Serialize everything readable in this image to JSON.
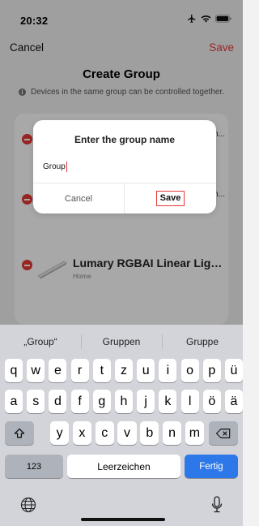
{
  "status": {
    "time": "20:32"
  },
  "nav": {
    "cancel": "Cancel",
    "save": "Save",
    "title": "Create Group",
    "info": "Devices in the same group can be controlled together."
  },
  "devices": [
    {
      "name": "",
      "room": "",
      "trailing": "h..."
    },
    {
      "name": "",
      "room": "",
      "trailing": "n..."
    },
    {
      "name": "Lumary RGBAI Linear Light...",
      "room": "Home"
    }
  ],
  "dialog": {
    "title": "Enter the group name",
    "value": "Group",
    "cancel": "Cancel",
    "save": "Save"
  },
  "keyboard": {
    "suggestions": [
      "„Group“",
      "Gruppen",
      "Gruppe"
    ],
    "row1": [
      "q",
      "w",
      "e",
      "r",
      "t",
      "z",
      "u",
      "i",
      "o",
      "p",
      "ü"
    ],
    "row2": [
      "a",
      "s",
      "d",
      "f",
      "g",
      "h",
      "j",
      "k",
      "l",
      "ö",
      "ä"
    ],
    "row3": [
      "y",
      "x",
      "c",
      "v",
      "b",
      "n",
      "m"
    ],
    "numbers": "123",
    "space": "Leerzeichen",
    "return": "Fertig"
  },
  "colors": {
    "accent": "#e53935",
    "return_key": "#2d78e8"
  }
}
